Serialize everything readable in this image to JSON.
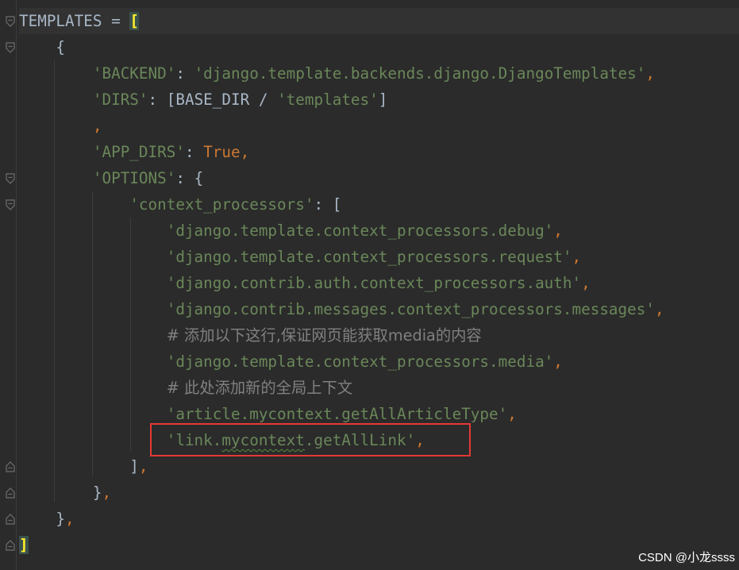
{
  "editor": {
    "lines": [
      {
        "parts": [
          {
            "t": "TEMPLATES",
            "c": "op"
          },
          {
            "t": " = ",
            "c": "op"
          },
          {
            "t": "[",
            "c": "bracket-hl"
          }
        ]
      },
      {
        "parts": [
          {
            "t": "    {",
            "c": "op"
          }
        ]
      },
      {
        "parts": [
          {
            "t": "        ",
            "c": "op"
          },
          {
            "t": "'BACKEND'",
            "c": "str"
          },
          {
            "t": ": ",
            "c": "op"
          },
          {
            "t": "'django.template.backends.django.DjangoTemplates'",
            "c": "str"
          },
          {
            "t": ",",
            "c": "kw"
          }
        ]
      },
      {
        "parts": [
          {
            "t": "        ",
            "c": "op"
          },
          {
            "t": "'DIRS'",
            "c": "str"
          },
          {
            "t": ": [BASE_DIR / ",
            "c": "op"
          },
          {
            "t": "'templates'",
            "c": "str"
          },
          {
            "t": "]",
            "c": "op"
          }
        ]
      },
      {
        "parts": [
          {
            "t": "        ",
            "c": "op"
          },
          {
            "t": ",",
            "c": "kw"
          }
        ]
      },
      {
        "parts": [
          {
            "t": "        ",
            "c": "op"
          },
          {
            "t": "'APP_DIRS'",
            "c": "str"
          },
          {
            "t": ": ",
            "c": "op"
          },
          {
            "t": "True",
            "c": "kw"
          },
          {
            "t": ",",
            "c": "kw"
          }
        ]
      },
      {
        "parts": [
          {
            "t": "        ",
            "c": "op"
          },
          {
            "t": "'OPTIONS'",
            "c": "str"
          },
          {
            "t": ": {",
            "c": "op"
          }
        ]
      },
      {
        "parts": [
          {
            "t": "            ",
            "c": "op"
          },
          {
            "t": "'context_processors'",
            "c": "str"
          },
          {
            "t": ": [",
            "c": "op"
          }
        ]
      },
      {
        "parts": [
          {
            "t": "                ",
            "c": "op"
          },
          {
            "t": "'django.template.context_processors.debug'",
            "c": "str"
          },
          {
            "t": ",",
            "c": "kw"
          }
        ]
      },
      {
        "parts": [
          {
            "t": "                ",
            "c": "op"
          },
          {
            "t": "'django.template.context_processors.request'",
            "c": "str"
          },
          {
            "t": ",",
            "c": "kw"
          }
        ]
      },
      {
        "parts": [
          {
            "t": "                ",
            "c": "op"
          },
          {
            "t": "'django.contrib.auth.context_processors.auth'",
            "c": "str"
          },
          {
            "t": ",",
            "c": "kw"
          }
        ]
      },
      {
        "parts": [
          {
            "t": "                ",
            "c": "op"
          },
          {
            "t": "'django.contrib.messages.context_processors.messages'",
            "c": "str"
          },
          {
            "t": ",",
            "c": "kw"
          }
        ]
      },
      {
        "parts": [
          {
            "t": "                ",
            "c": "op"
          },
          {
            "t": "# 添加以下这行,保证网页能获取",
            "c": "cmt"
          },
          {
            "t": "media",
            "c": "cmt mono"
          },
          {
            "t": "的内容",
            "c": "cmt"
          }
        ]
      },
      {
        "parts": [
          {
            "t": "                ",
            "c": "op"
          },
          {
            "t": "'django.template.context_processors.media'",
            "c": "str"
          },
          {
            "t": ",",
            "c": "kw"
          }
        ]
      },
      {
        "parts": [
          {
            "t": "                ",
            "c": "op"
          },
          {
            "t": "# 此处添加新的全局上下文",
            "c": "cmt"
          }
        ]
      },
      {
        "parts": [
          {
            "t": "                ",
            "c": "op"
          },
          {
            "t": "'article.mycontext.getAllArticleType'",
            "c": "str"
          },
          {
            "t": ",",
            "c": "kw"
          }
        ]
      },
      {
        "parts": [
          {
            "t": "                ",
            "c": "op"
          },
          {
            "t": "'link.",
            "c": "str"
          },
          {
            "t": "mycontext",
            "c": "str squiggle"
          },
          {
            "t": ".getAllLink'",
            "c": "str"
          },
          {
            "t": ",",
            "c": "kw"
          }
        ]
      },
      {
        "parts": [
          {
            "t": "            ]",
            "c": "op"
          },
          {
            "t": ",",
            "c": "kw"
          }
        ]
      },
      {
        "parts": [
          {
            "t": "        }",
            "c": "op"
          },
          {
            "t": ",",
            "c": "kw"
          }
        ]
      },
      {
        "parts": [
          {
            "t": "    }",
            "c": "op"
          },
          {
            "t": ",",
            "c": "kw"
          }
        ]
      },
      {
        "parts": [
          {
            "t": "]",
            "c": "bracket-hl"
          }
        ]
      }
    ]
  },
  "watermark": "CSDN @小龙ssss",
  "colors": {
    "background": "#2b2b2b",
    "string": "#6a8759",
    "keyword": "#cc7832",
    "text": "#a9b7c6",
    "comment": "#808080",
    "bracket_match": "#ffef28",
    "annotation_box": "#e53935"
  },
  "gutter_icons": [
    "fold-open-icon",
    "fold-open-icon",
    "fold-open-icon",
    "fold-open-icon",
    "fold-close-icon",
    "fold-close-icon",
    "fold-close-icon",
    "fold-close-icon"
  ]
}
